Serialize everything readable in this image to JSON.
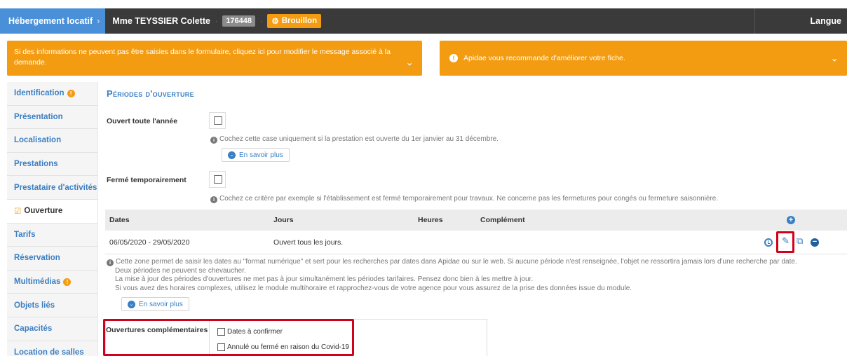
{
  "topbar": {
    "module": "Hébergement locatif",
    "chevron": "›",
    "name": "Mme TEYSSIER Colette",
    "sep1": "·",
    "object_id": "176448",
    "sep2": "·",
    "status": "Brouillon",
    "lang": "Langue"
  },
  "alerts": {
    "left": "Si des informations ne peuvent pas être saisies dans le formulaire, cliquez ici pour modifier le message associé à la demande.",
    "right": "Apidae vous recommande d'améliorer votre fiche.",
    "caret": "⌄"
  },
  "sidebar": {
    "items": [
      {
        "label": "Identification",
        "warn": "!"
      },
      {
        "label": "Présentation"
      },
      {
        "label": "Localisation"
      },
      {
        "label": "Prestations"
      },
      {
        "label": "Prestataire d'activités"
      },
      {
        "label": "Ouverture"
      },
      {
        "label": "Tarifs"
      },
      {
        "label": "Réservation"
      },
      {
        "label": "Multimédias",
        "warn": "!"
      },
      {
        "label": "Objets liés"
      },
      {
        "label": "Capacités"
      },
      {
        "label": "Location de salles"
      }
    ],
    "active_icon": "☑"
  },
  "main": {
    "title": "Périodes d'ouverture",
    "open_all_year": {
      "label": "Ouvert toute l'année",
      "help": "Cochez cette case uniquement si la prestation est ouverte du 1er janvier au 31 décembre.",
      "more": "En savoir plus"
    },
    "closed_temp": {
      "label": "Fermé temporairement",
      "help": "Cochez ce critère par exemple si l'établissement est fermé temporairement pour travaux. Ne concerne pas les fermetures pour congés ou fermeture saisonnière."
    },
    "table": {
      "headers": [
        "Dates",
        "Jours",
        "Heures",
        "Complément"
      ],
      "rows": [
        {
          "dates": "06/05/2020 - 29/05/2020",
          "jours": "Ouvert tous les jours.",
          "heures": "",
          "complement": ""
        }
      ]
    },
    "long_help": [
      "Cette zone permet de saisir les dates au \"format numérique\" et sert pour les recherches par dates dans Apidae ou sur le web. Si aucune période n'est renseignée, l'objet ne ressortira jamais lors d'une recherche par date.",
      "Deux périodes ne peuvent se chevaucher.",
      "La mise à jour des périodes d'ouvertures ne met pas à jour simultanément les périodes tarifaires. Pensez donc bien à les mettre à jour.",
      "Si vous avez des horaires complexes, utilisez le module multihoraire et rapprochez-vous de votre agence pour vous assurez de la prise des données issue du module."
    ],
    "more2": "En savoir plus",
    "complementary": {
      "label": "Ouvertures complémentaires",
      "options": [
        "Dates à confirmer",
        "Annulé ou fermé en raison du Covid-19"
      ]
    }
  },
  "icons": {
    "info": "i",
    "chevron_down": "⌄",
    "plus": "+",
    "minus": "−",
    "pencil": "✎",
    "copy": "⧉",
    "gear": "⚙"
  },
  "colors": {
    "accent_blue": "#3b7fc4",
    "topbar": "#3a3a3a",
    "warning_orange": "#f39c12",
    "highlight_red": "#d0021b"
  }
}
